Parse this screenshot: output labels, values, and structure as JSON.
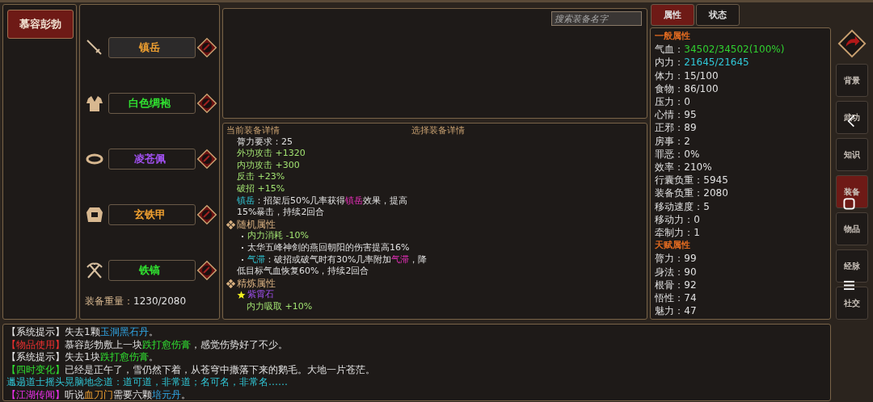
{
  "character": {
    "name": "慕容彭勃",
    "selected": true
  },
  "equipment": {
    "slots": [
      {
        "kind": "weapon",
        "name": "镇岳",
        "color": "#f0a030",
        "selected": true
      },
      {
        "kind": "robe",
        "name": "白色绸袍",
        "color": "#30e030",
        "selected": false
      },
      {
        "kind": "ring",
        "name": "凌苍佩",
        "color": "#a050f0",
        "selected": false
      },
      {
        "kind": "armor",
        "name": "玄铁甲",
        "color": "#f0a030",
        "selected": false
      },
      {
        "kind": "tool",
        "name": "铁镐",
        "color": "#30e030",
        "selected": false
      }
    ],
    "weight_label": "装备重量：",
    "weight_value": "1230/2080"
  },
  "search": {
    "placeholder": "搜索装备名字"
  },
  "details": {
    "current_title": "当前装备详情",
    "selected_title": "选择装备详情",
    "lines": [
      {
        "kind": "stat",
        "segments": [
          {
            "text": "膂力要求：25",
            "kind": "text"
          }
        ]
      },
      {
        "kind": "stat",
        "segments": [
          {
            "text": "外功攻击 +1320",
            "kind": "bonus"
          }
        ]
      },
      {
        "kind": "stat",
        "segments": [
          {
            "text": "内功攻击 +300",
            "kind": "bonus"
          }
        ]
      },
      {
        "kind": "stat",
        "segments": [
          {
            "text": "反击 +23%",
            "kind": "bonus"
          }
        ]
      },
      {
        "kind": "stat",
        "segments": [
          {
            "text": "破招 +15%",
            "kind": "bonus"
          }
        ]
      },
      {
        "kind": "stat",
        "segments": [
          {
            "text": "镇岳",
            "kind": "skill"
          },
          {
            "text": "：招架后50%几率获得",
            "kind": "text"
          },
          {
            "text": "镇岳",
            "kind": "effect"
          },
          {
            "text": "效果，提高",
            "kind": "text"
          }
        ]
      },
      {
        "kind": "stat",
        "segments": [
          {
            "text": "15%暴击，持续2回合",
            "kind": "text"
          }
        ]
      },
      {
        "kind": "section",
        "segments": [
          {
            "text": "随机属性",
            "kind": "heading"
          }
        ]
      },
      {
        "kind": "bullet",
        "segments": [
          {
            "text": "内力消耗 -10%",
            "kind": "bonus"
          }
        ]
      },
      {
        "kind": "bullet",
        "segments": [
          {
            "text": "太华五峰神剑的燕回朝阳的伤害提高16%",
            "kind": "text"
          }
        ]
      },
      {
        "kind": "bullet",
        "segments": [
          {
            "text": "气滞",
            "kind": "skill"
          },
          {
            "text": "：破招或破气时有30%几率附加",
            "kind": "text"
          },
          {
            "text": "气滞",
            "kind": "effect"
          },
          {
            "text": "，降",
            "kind": "text"
          }
        ]
      },
      {
        "kind": "stat",
        "segments": [
          {
            "text": "低目标气血恢复60%，持续2回合",
            "kind": "text"
          }
        ]
      },
      {
        "kind": "section",
        "segments": [
          {
            "text": "精炼属性",
            "kind": "heading"
          }
        ]
      },
      {
        "kind": "gem",
        "segments": [
          {
            "text": "紫霄石",
            "kind": "gem"
          }
        ]
      },
      {
        "kind": "sub",
        "segments": [
          {
            "text": "内力吸取 +10%",
            "kind": "bonus"
          }
        ]
      }
    ]
  },
  "stats_tabs": [
    {
      "label": "属性",
      "selected": true
    },
    {
      "label": "状态",
      "selected": false
    }
  ],
  "stats_sections": [
    {
      "title": "一般属性",
      "rows": [
        {
          "label": "气血：",
          "value": "34502/34502(100%)",
          "color": "#30d030"
        },
        {
          "label": "内力：",
          "value": "21645/21645",
          "color": "#30c8d8"
        },
        {
          "label": "体力：",
          "value": "15/100",
          "color": "#e0e0e0"
        },
        {
          "label": "食物：",
          "value": "86/100",
          "color": "#e0e0e0"
        },
        {
          "label": "压力：",
          "value": "0",
          "color": "#e0e0e0"
        },
        {
          "label": "心情：",
          "value": "95",
          "color": "#e0e0e0"
        },
        {
          "label": "正邪：",
          "value": "89",
          "color": "#e0e0e0"
        },
        {
          "label": "房事：",
          "value": "2",
          "color": "#e0e0e0"
        },
        {
          "label": "罪恶：",
          "value": "0%",
          "color": "#e0e0e0"
        },
        {
          "label": "效率：",
          "value": "210%",
          "color": "#e0e0e0"
        },
        {
          "label": "行囊负重：",
          "value": "5945",
          "color": "#e0e0e0"
        },
        {
          "label": "装备负重：",
          "value": "2080",
          "color": "#e0e0e0"
        },
        {
          "label": "移动速度：",
          "value": "5",
          "color": "#e0e0e0"
        },
        {
          "label": "移动力：",
          "value": "0",
          "color": "#e0e0e0"
        },
        {
          "label": "牵制力：",
          "value": "1",
          "color": "#e0e0e0"
        }
      ]
    },
    {
      "title": "天赋属性",
      "rows": [
        {
          "label": "膂力：",
          "value": "99",
          "color": "#e0e0e0"
        },
        {
          "label": "身法：",
          "value": "90",
          "color": "#e0e0e0"
        },
        {
          "label": "根骨：",
          "value": "92",
          "color": "#e0e0e0"
        },
        {
          "label": "悟性：",
          "value": "74",
          "color": "#e0e0e0"
        },
        {
          "label": "魅力：",
          "value": "47",
          "color": "#e0e0e0"
        }
      ]
    }
  ],
  "nav": [
    {
      "label": "背景",
      "selected": false
    },
    {
      "label": "武功",
      "selected": false
    },
    {
      "label": "知识",
      "selected": false
    },
    {
      "label": "装备",
      "selected": true
    },
    {
      "label": "物品",
      "selected": false
    },
    {
      "label": "经脉",
      "selected": false
    },
    {
      "label": "社交",
      "selected": false
    }
  ],
  "log": [
    {
      "segments": [
        {
          "text": "【系统提示】",
          "kind": "system"
        },
        {
          "text": "失去1颗",
          "kind": "text"
        },
        {
          "text": "玉洞黑石丹",
          "kind": "item"
        },
        {
          "text": "。",
          "kind": "text"
        }
      ]
    },
    {
      "segments": [
        {
          "text": "【物品使用】",
          "kind": "use"
        },
        {
          "text": "慕容彭勃敷上一块",
          "kind": "text"
        },
        {
          "text": "跌打愈伤膏",
          "kind": "medicine"
        },
        {
          "text": "，感觉伤势好了不少。",
          "kind": "text"
        }
      ]
    },
    {
      "segments": [
        {
          "text": "【系统提示】",
          "kind": "system"
        },
        {
          "text": "失去1块",
          "kind": "text"
        },
        {
          "text": "跌打愈伤膏",
          "kind": "medicine"
        },
        {
          "text": "。",
          "kind": "text"
        }
      ]
    },
    {
      "segments": [
        {
          "text": "【四时变化】",
          "kind": "season"
        },
        {
          "text": "已经是正午了，雪仍然下着，从苍穹中撒落下来的鹅毛。大地一片苍茫。",
          "kind": "text"
        }
      ]
    },
    {
      "segments": [
        {
          "text": "邋遢道士摇头晃脑地念道：道可道，非常道；名可名，非常名……",
          "kind": "speech"
        }
      ]
    },
    {
      "segments": [
        {
          "text": "【江湖传闻】",
          "kind": "rumor"
        },
        {
          "text": "听说",
          "kind": "text"
        },
        {
          "text": "血刀门",
          "kind": "place"
        },
        {
          "text": "需要六颗",
          "kind": "text"
        },
        {
          "text": "培元丹",
          "kind": "item"
        },
        {
          "text": "。",
          "kind": "text"
        }
      ]
    }
  ]
}
